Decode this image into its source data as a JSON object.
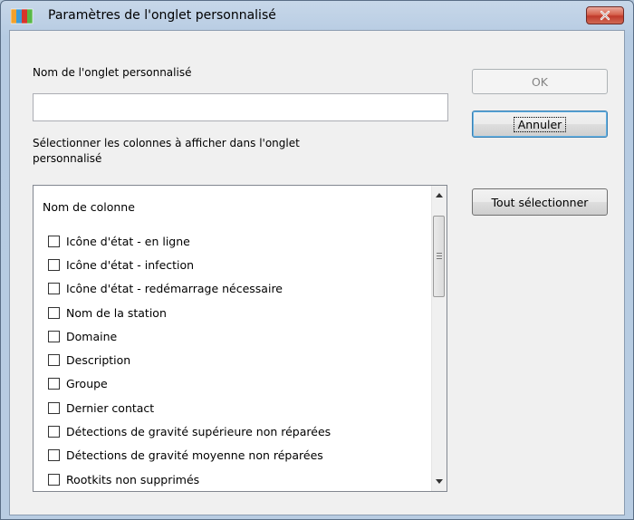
{
  "window": {
    "title": "Paramètres de l'onglet personnalisé",
    "icon": "avg-logo-icon",
    "close_icon": "close-icon"
  },
  "form": {
    "tab_name_label": "Nom de l'onglet personnalisé",
    "tab_name_value": "",
    "columns_label_line1": "Sélectionner les colonnes à afficher dans l'onglet",
    "columns_label_line2": "personnalisé"
  },
  "buttons": {
    "ok": "OK",
    "cancel": "Annuler",
    "select_all": "Tout sélectionner"
  },
  "column_list": {
    "header": "Nom de colonne",
    "items": [
      {
        "label": "Icône d'état - en ligne",
        "checked": false
      },
      {
        "label": "Icône d'état - infection",
        "checked": false
      },
      {
        "label": "Icône d'état - redémarrage nécessaire",
        "checked": false
      },
      {
        "label": "Nom de la station",
        "checked": false
      },
      {
        "label": "Domaine",
        "checked": false
      },
      {
        "label": "Description",
        "checked": false
      },
      {
        "label": "Groupe",
        "checked": false
      },
      {
        "label": "Dernier contact",
        "checked": false
      },
      {
        "label": "Détections de gravité supérieure non réparées",
        "checked": false
      },
      {
        "label": "Détections de gravité moyenne non réparées",
        "checked": false
      },
      {
        "label": "Rootkits non supprimés",
        "checked": false
      }
    ]
  },
  "colors": {
    "frame": "#b8cce2",
    "client_bg": "#f0f0f0",
    "close_button": "#c0392b"
  }
}
